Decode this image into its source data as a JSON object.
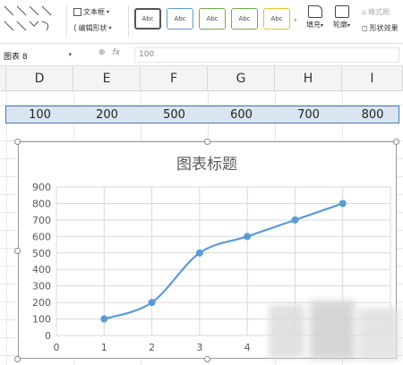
{
  "ribbon": {
    "text_box_label": "文本框",
    "edit_shape_label": "编辑形状",
    "style_sample": "Abc",
    "fill_label": "填充",
    "outline_label": "轮廓",
    "format_painter_label": "格式刷",
    "shape_effects_label": "形状效果"
  },
  "formula_bar": {
    "name_box": "图表 8",
    "fx_symbol": "fx",
    "value": "100"
  },
  "columns": [
    "D",
    "E",
    "F",
    "G",
    "H",
    "I"
  ],
  "row_values": [
    "100",
    "200",
    "500",
    "600",
    "700",
    "800"
  ],
  "colors": {
    "accent": "#5b9bd5",
    "selection": "#dbe5f1",
    "grid": "#d9d9d9"
  },
  "chart_data": {
    "type": "scatter",
    "title": "图表标题",
    "x": [
      1,
      2,
      3,
      4,
      5,
      6
    ],
    "y": [
      100,
      200,
      500,
      600,
      700,
      800
    ],
    "xlim": [
      0,
      7
    ],
    "ylim": [
      0,
      900
    ],
    "x_ticks": [
      "0",
      "1",
      "2",
      "3",
      "4"
    ],
    "y_ticks": [
      "0",
      "100",
      "200",
      "300",
      "400",
      "500",
      "600",
      "700",
      "800",
      "900"
    ],
    "smoothed": true,
    "grid": true,
    "marker": "circle",
    "color": "#5b9bd5"
  }
}
